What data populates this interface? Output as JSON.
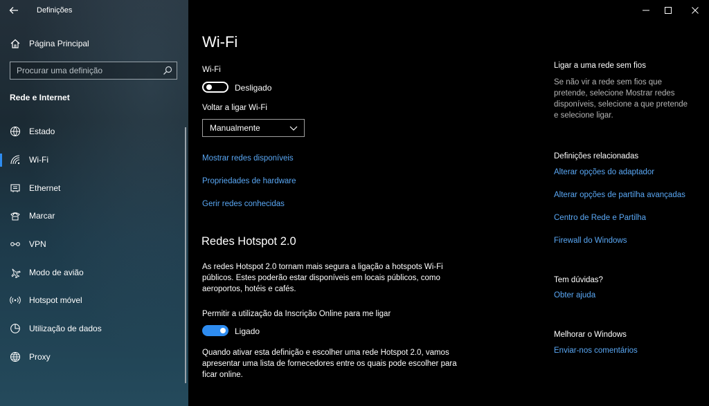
{
  "app": {
    "title": "Definições"
  },
  "sidebar": {
    "home_label": "Página Principal",
    "search_placeholder": "Procurar uma definição",
    "section_title": "Rede e Internet",
    "items": [
      {
        "label": "Estado",
        "icon": "globe-status-icon",
        "active": false
      },
      {
        "label": "Wi-Fi",
        "icon": "wifi-icon",
        "active": true
      },
      {
        "label": "Ethernet",
        "icon": "ethernet-icon",
        "active": false
      },
      {
        "label": "Marcar",
        "icon": "dial-up-icon",
        "active": false
      },
      {
        "label": "VPN",
        "icon": "vpn-icon",
        "active": false
      },
      {
        "label": "Modo de avião",
        "icon": "airplane-icon",
        "active": false
      },
      {
        "label": "Hotspot móvel",
        "icon": "hotspot-icon",
        "active": false
      },
      {
        "label": "Utilização de dados",
        "icon": "data-usage-icon",
        "active": false
      },
      {
        "label": "Proxy",
        "icon": "globe-icon",
        "active": false
      }
    ]
  },
  "main": {
    "title": "Wi-Fi",
    "wifi_label": "Wi-Fi",
    "wifi_toggle_state": "Desligado",
    "turn_back_on_label": "Voltar a ligar Wi-Fi",
    "turn_back_on_value": "Manualmente",
    "links": {
      "show_networks": "Mostrar redes disponíveis",
      "hardware_properties": "Propriedades de hardware",
      "manage_known": "Gerir redes conhecidas"
    },
    "hotspot": {
      "title": "Redes Hotspot 2.0",
      "desc_lines": [
        "As redes Hotspot 2.0 tornam mais segura a ligação a hotspots Wi-Fi",
        "públicos. Estes poderão estar disponíveis em locais públicos, como",
        "aeroportos, hotéis e cafés."
      ],
      "permit_label": "Permitir a utilização da Inscrição Online para me ligar",
      "permit_toggle_state": "Ligado",
      "note_lines": [
        "Quando ativar esta definição e escolher uma rede Hotspot 2.0, vamos",
        "apresentar uma lista de fornecedores entre os quais pode escolher para",
        "ficar online."
      ]
    }
  },
  "right": {
    "connect_title": "Ligar a uma rede sem fios",
    "connect_lines": [
      "Se não vir a rede sem fios que",
      "pretende, selecione Mostrar redes",
      "disponíveis, selecione a que pretende",
      "e selecione ligar."
    ],
    "related_title": "Definições relacionadas",
    "related_links": [
      "Alterar opções do adaptador",
      "Alterar opções de partilha avançadas",
      "Centro de Rede e Partilha",
      "Firewall do Windows"
    ],
    "questions_title": "Tem dúvidas?",
    "help_link": "Obter ajuda",
    "improve_title": "Melhorar o Windows",
    "feedback_link": "Enviar-nos comentários"
  },
  "colors": {
    "accent": "#2e8cf0",
    "link": "#5aa8f5"
  }
}
